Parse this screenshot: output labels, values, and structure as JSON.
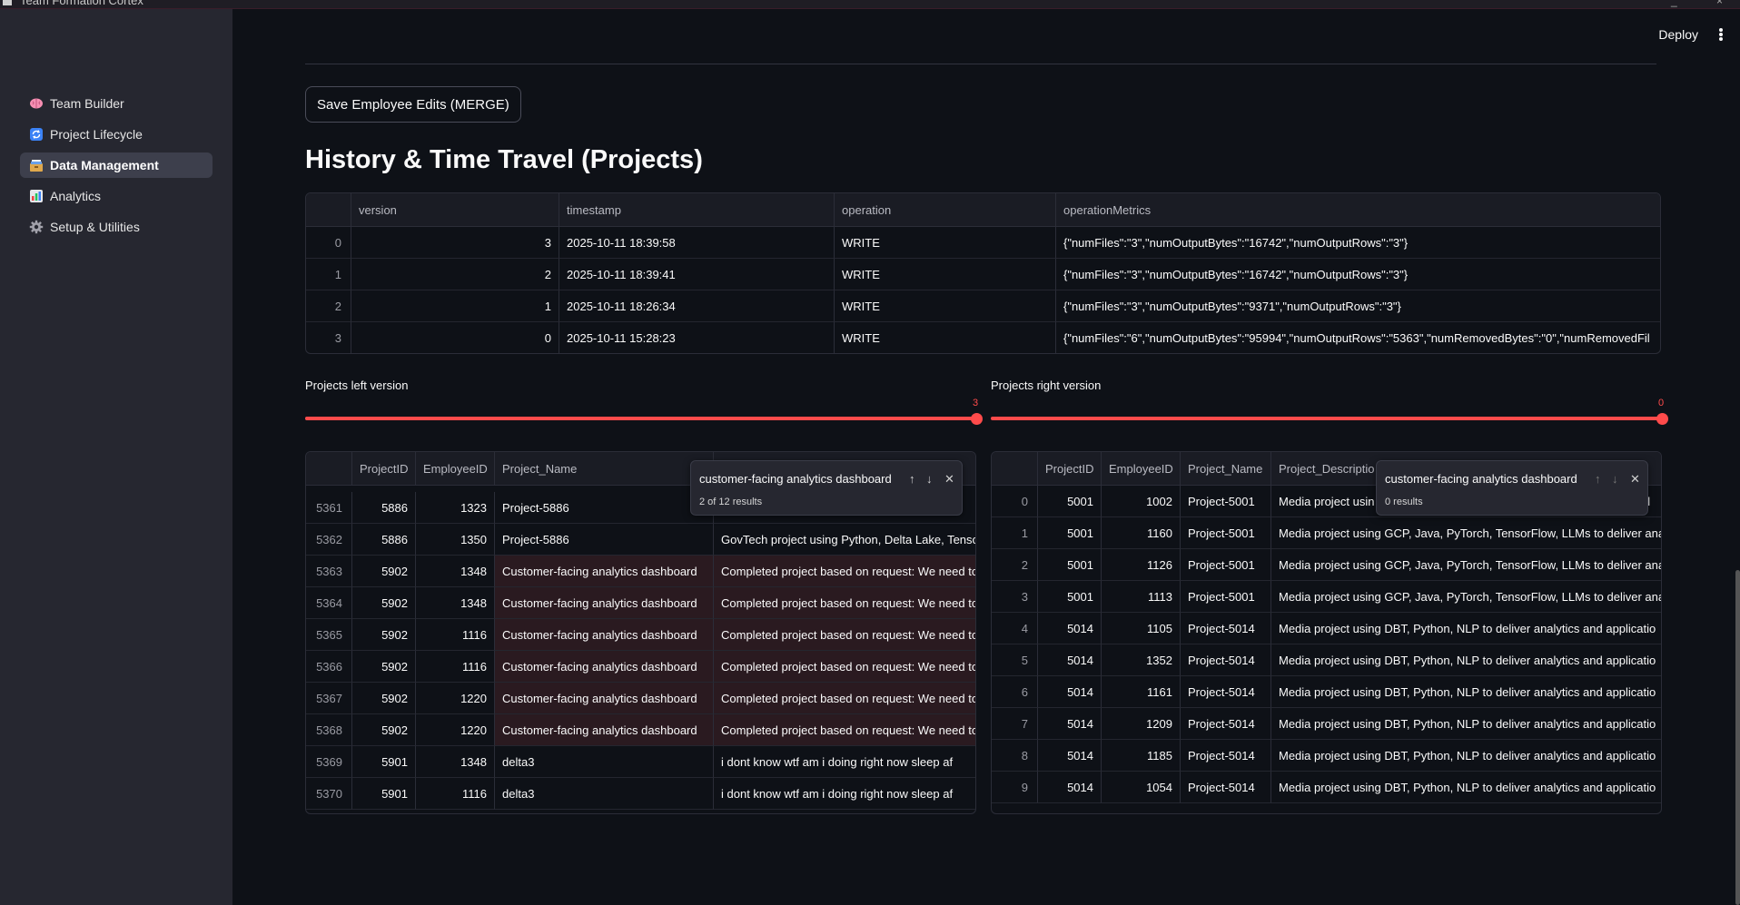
{
  "window": {
    "title": "Team Formation Cortex"
  },
  "header": {
    "deploy_label": "Deploy"
  },
  "sidebar": {
    "items": [
      {
        "label": "Team Builder",
        "icon": "brain-icon"
      },
      {
        "label": "Project Lifecycle",
        "icon": "cycle-icon"
      },
      {
        "label": "Data Management",
        "icon": "card-file-box-icon",
        "active": true
      },
      {
        "label": "Analytics",
        "icon": "bar-chart-icon"
      },
      {
        "label": "Setup & Utilities",
        "icon": "gear-icon"
      }
    ]
  },
  "main": {
    "save_button": "Save Employee Edits (MERGE)",
    "history_title": "History & Time Travel (Projects)",
    "history_table": {
      "columns": [
        "",
        "version",
        "timestamp",
        "operation",
        "operationMetrics"
      ],
      "rows": [
        [
          "0",
          "3",
          "2025-10-11 18:39:58",
          "WRITE",
          "{\"numFiles\":\"3\",\"numOutputBytes\":\"16742\",\"numOutputRows\":\"3\"}"
        ],
        [
          "1",
          "2",
          "2025-10-11 18:39:41",
          "WRITE",
          "{\"numFiles\":\"3\",\"numOutputBytes\":\"16742\",\"numOutputRows\":\"3\"}"
        ],
        [
          "2",
          "1",
          "2025-10-11 18:26:34",
          "WRITE",
          "{\"numFiles\":\"3\",\"numOutputBytes\":\"9371\",\"numOutputRows\":\"3\"}"
        ],
        [
          "3",
          "0",
          "2025-10-11 15:28:23",
          "WRITE",
          "{\"numFiles\":\"6\",\"numOutputBytes\":\"95994\",\"numOutputRows\":\"5363\",\"numRemovedBytes\":\"0\",\"numRemovedFil"
        ]
      ]
    },
    "left_slider": {
      "label": "Projects left version",
      "value": "3",
      "min": 0,
      "max": 3,
      "value_num": 3
    },
    "right_slider": {
      "label": "Projects right version",
      "value": "0",
      "min": 0,
      "max": 3,
      "value_num": 0
    },
    "left_table": {
      "columns": [
        "",
        "ProjectID",
        "EmployeeID",
        "Project_Name",
        ""
      ],
      "rows": [
        [
          "5361",
          "5886",
          "1323",
          "Project-5886",
          "o"
        ],
        [
          "5362",
          "5886",
          "1350",
          "Project-5886",
          "GovTech project using Python, Delta Lake, Tenso"
        ],
        [
          "5363",
          "5902",
          "1348",
          "Customer-facing analytics dashboard",
          "Completed project based on request: We need to"
        ],
        [
          "5364",
          "5902",
          "1348",
          "Customer-facing analytics dashboard",
          "Completed project based on request: We need to"
        ],
        [
          "5365",
          "5902",
          "1116",
          "Customer-facing analytics dashboard",
          "Completed project based on request: We need to"
        ],
        [
          "5366",
          "5902",
          "1116",
          "Customer-facing analytics dashboard",
          "Completed project based on request: We need to"
        ],
        [
          "5367",
          "5902",
          "1220",
          "Customer-facing analytics dashboard",
          "Completed project based on request: We need to"
        ],
        [
          "5368",
          "5902",
          "1220",
          "Customer-facing analytics dashboard",
          "Completed project based on request: We need to"
        ],
        [
          "5369",
          "5901",
          "1348",
          "delta3",
          "i dont know wtf am i doing right now sleep af"
        ],
        [
          "5370",
          "5901",
          "1116",
          "delta3",
          "i dont know wtf am i doing right now sleep af"
        ]
      ],
      "search": {
        "query": "customer-facing analytics dashboard",
        "results": "2 of 12 results"
      }
    },
    "right_table": {
      "columns": [
        "",
        "ProjectID",
        "EmployeeID",
        "Project_Name",
        "Project_Descriptio"
      ],
      "rows": [
        [
          "0",
          "5001",
          "1002",
          "Project-5001",
          "Media project usin",
          "al"
        ],
        [
          "1",
          "5001",
          "1160",
          "Project-5001",
          "Media project using GCP, Java, PyTorch, TensorFlow, LLMs to deliver anal"
        ],
        [
          "2",
          "5001",
          "1126",
          "Project-5001",
          "Media project using GCP, Java, PyTorch, TensorFlow, LLMs to deliver anal"
        ],
        [
          "3",
          "5001",
          "1113",
          "Project-5001",
          "Media project using GCP, Java, PyTorch, TensorFlow, LLMs to deliver anal"
        ],
        [
          "4",
          "5014",
          "1105",
          "Project-5014",
          "Media project using DBT, Python, NLP to deliver analytics and applicatio"
        ],
        [
          "5",
          "5014",
          "1352",
          "Project-5014",
          "Media project using DBT, Python, NLP to deliver analytics and applicatio"
        ],
        [
          "6",
          "5014",
          "1161",
          "Project-5014",
          "Media project using DBT, Python, NLP to deliver analytics and applicatio"
        ],
        [
          "7",
          "5014",
          "1209",
          "Project-5014",
          "Media project using DBT, Python, NLP to deliver analytics and applicatio"
        ],
        [
          "8",
          "5014",
          "1185",
          "Project-5014",
          "Media project using DBT, Python, NLP to deliver analytics and applicatio"
        ],
        [
          "9",
          "5014",
          "1054",
          "Project-5014",
          "Media project using DBT, Python, NLP to deliver analytics and applicatio"
        ]
      ],
      "search": {
        "query": "customer-facing analytics dashboard",
        "results": "0 results"
      }
    }
  },
  "colors": {
    "accent": "#ff4b4b",
    "background": "#0e1117",
    "sidebar": "#262730",
    "highlight_row": "#2a1a20"
  }
}
